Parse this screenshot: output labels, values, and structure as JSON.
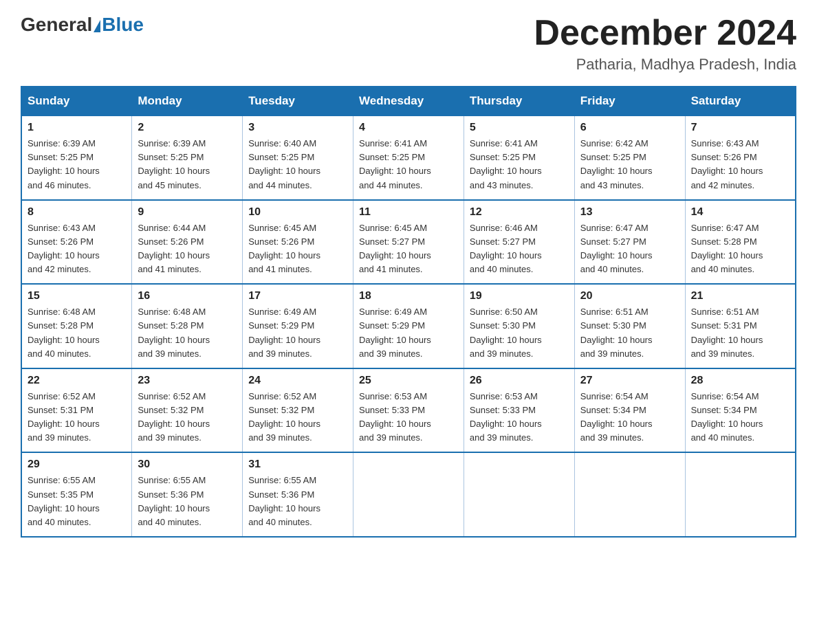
{
  "header": {
    "logo_general": "General",
    "logo_blue": "Blue",
    "month_year": "December 2024",
    "location": "Patharia, Madhya Pradesh, India"
  },
  "weekdays": [
    "Sunday",
    "Monday",
    "Tuesday",
    "Wednesday",
    "Thursday",
    "Friday",
    "Saturday"
  ],
  "weeks": [
    [
      {
        "day": "1",
        "sunrise": "6:39 AM",
        "sunset": "5:25 PM",
        "daylight": "10 hours and 46 minutes."
      },
      {
        "day": "2",
        "sunrise": "6:39 AM",
        "sunset": "5:25 PM",
        "daylight": "10 hours and 45 minutes."
      },
      {
        "day": "3",
        "sunrise": "6:40 AM",
        "sunset": "5:25 PM",
        "daylight": "10 hours and 44 minutes."
      },
      {
        "day": "4",
        "sunrise": "6:41 AM",
        "sunset": "5:25 PM",
        "daylight": "10 hours and 44 minutes."
      },
      {
        "day": "5",
        "sunrise": "6:41 AM",
        "sunset": "5:25 PM",
        "daylight": "10 hours and 43 minutes."
      },
      {
        "day": "6",
        "sunrise": "6:42 AM",
        "sunset": "5:25 PM",
        "daylight": "10 hours and 43 minutes."
      },
      {
        "day": "7",
        "sunrise": "6:43 AM",
        "sunset": "5:26 PM",
        "daylight": "10 hours and 42 minutes."
      }
    ],
    [
      {
        "day": "8",
        "sunrise": "6:43 AM",
        "sunset": "5:26 PM",
        "daylight": "10 hours and 42 minutes."
      },
      {
        "day": "9",
        "sunrise": "6:44 AM",
        "sunset": "5:26 PM",
        "daylight": "10 hours and 41 minutes."
      },
      {
        "day": "10",
        "sunrise": "6:45 AM",
        "sunset": "5:26 PM",
        "daylight": "10 hours and 41 minutes."
      },
      {
        "day": "11",
        "sunrise": "6:45 AM",
        "sunset": "5:27 PM",
        "daylight": "10 hours and 41 minutes."
      },
      {
        "day": "12",
        "sunrise": "6:46 AM",
        "sunset": "5:27 PM",
        "daylight": "10 hours and 40 minutes."
      },
      {
        "day": "13",
        "sunrise": "6:47 AM",
        "sunset": "5:27 PM",
        "daylight": "10 hours and 40 minutes."
      },
      {
        "day": "14",
        "sunrise": "6:47 AM",
        "sunset": "5:28 PM",
        "daylight": "10 hours and 40 minutes."
      }
    ],
    [
      {
        "day": "15",
        "sunrise": "6:48 AM",
        "sunset": "5:28 PM",
        "daylight": "10 hours and 40 minutes."
      },
      {
        "day": "16",
        "sunrise": "6:48 AM",
        "sunset": "5:28 PM",
        "daylight": "10 hours and 39 minutes."
      },
      {
        "day": "17",
        "sunrise": "6:49 AM",
        "sunset": "5:29 PM",
        "daylight": "10 hours and 39 minutes."
      },
      {
        "day": "18",
        "sunrise": "6:49 AM",
        "sunset": "5:29 PM",
        "daylight": "10 hours and 39 minutes."
      },
      {
        "day": "19",
        "sunrise": "6:50 AM",
        "sunset": "5:30 PM",
        "daylight": "10 hours and 39 minutes."
      },
      {
        "day": "20",
        "sunrise": "6:51 AM",
        "sunset": "5:30 PM",
        "daylight": "10 hours and 39 minutes."
      },
      {
        "day": "21",
        "sunrise": "6:51 AM",
        "sunset": "5:31 PM",
        "daylight": "10 hours and 39 minutes."
      }
    ],
    [
      {
        "day": "22",
        "sunrise": "6:52 AM",
        "sunset": "5:31 PM",
        "daylight": "10 hours and 39 minutes."
      },
      {
        "day": "23",
        "sunrise": "6:52 AM",
        "sunset": "5:32 PM",
        "daylight": "10 hours and 39 minutes."
      },
      {
        "day": "24",
        "sunrise": "6:52 AM",
        "sunset": "5:32 PM",
        "daylight": "10 hours and 39 minutes."
      },
      {
        "day": "25",
        "sunrise": "6:53 AM",
        "sunset": "5:33 PM",
        "daylight": "10 hours and 39 minutes."
      },
      {
        "day": "26",
        "sunrise": "6:53 AM",
        "sunset": "5:33 PM",
        "daylight": "10 hours and 39 minutes."
      },
      {
        "day": "27",
        "sunrise": "6:54 AM",
        "sunset": "5:34 PM",
        "daylight": "10 hours and 39 minutes."
      },
      {
        "day": "28",
        "sunrise": "6:54 AM",
        "sunset": "5:34 PM",
        "daylight": "10 hours and 40 minutes."
      }
    ],
    [
      {
        "day": "29",
        "sunrise": "6:55 AM",
        "sunset": "5:35 PM",
        "daylight": "10 hours and 40 minutes."
      },
      {
        "day": "30",
        "sunrise": "6:55 AM",
        "sunset": "5:36 PM",
        "daylight": "10 hours and 40 minutes."
      },
      {
        "day": "31",
        "sunrise": "6:55 AM",
        "sunset": "5:36 PM",
        "daylight": "10 hours and 40 minutes."
      },
      null,
      null,
      null,
      null
    ]
  ],
  "labels": {
    "sunrise_prefix": "Sunrise: ",
    "sunset_prefix": "Sunset: ",
    "daylight_prefix": "Daylight: "
  }
}
